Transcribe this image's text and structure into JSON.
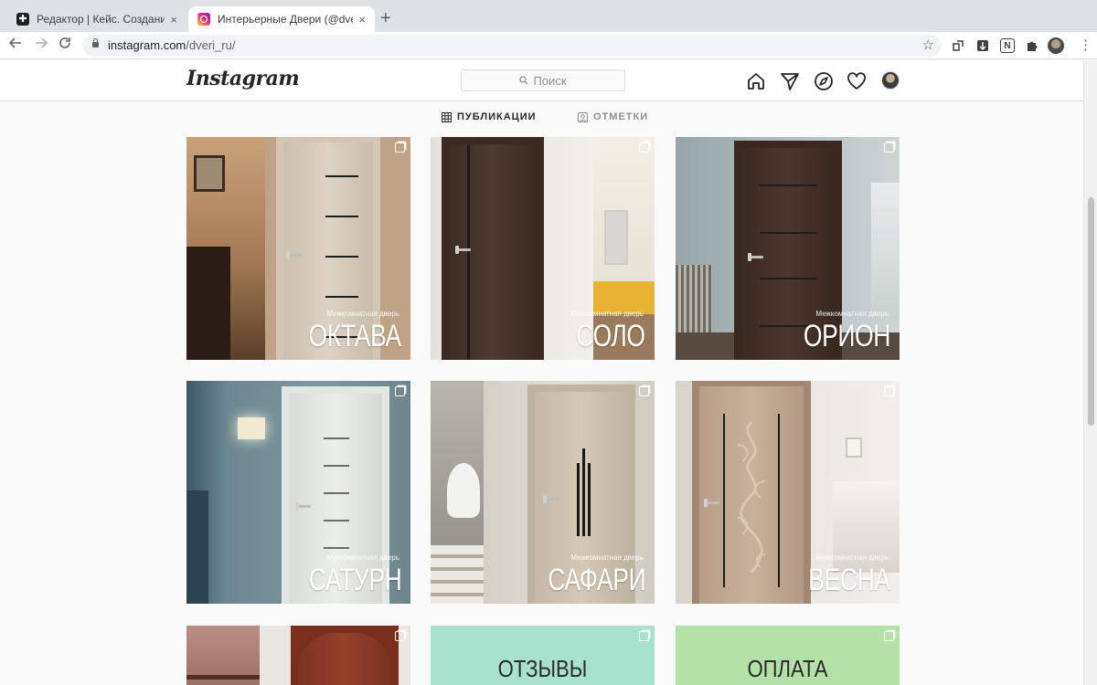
{
  "browser": {
    "tabs": [
      {
        "title": "Редактор | Кейс. Создание и",
        "close": "×",
        "favicon_text": "✚"
      },
      {
        "title": "Интерьерные Двери (@dveri_",
        "close": "×"
      }
    ],
    "new_tab": "+",
    "url_host": "instagram.com",
    "url_path": "/dveri_ru/",
    "extension_notion": "N"
  },
  "instagram": {
    "logo": "Instagram",
    "search_placeholder": "Поиск",
    "tabs": [
      {
        "label": "ПУБЛИКАЦИИ",
        "active": true
      },
      {
        "label": "ОТМЕТКИ",
        "active": false
      }
    ],
    "posts": [
      {
        "subtitle": "Межкомнатная дверь",
        "title": "ОКТАВА"
      },
      {
        "subtitle": "Межкомнатная дверь",
        "title": "СОЛО"
      },
      {
        "subtitle": "Межкомнатная дверь",
        "title": "ОРИОН"
      },
      {
        "subtitle": "Межкомнатная дверь",
        "title": "САТУРН"
      },
      {
        "subtitle": "Межкомнатная дверь",
        "title": "САФАРИ"
      },
      {
        "subtitle": "Межкомнатная дверь",
        "title": "ВЕСНА"
      },
      {
        "subtitle": "",
        "title": ""
      },
      {
        "subtitle": "",
        "title": "ОТЗЫВЫ"
      },
      {
        "subtitle": "",
        "title": "ОПЛАТА"
      }
    ]
  },
  "colors": {
    "promo_mint": "#a8e2cf",
    "promo_green": "#b3e1a7",
    "ig_text": "#262626",
    "ig_muted": "#8e8e8e"
  }
}
